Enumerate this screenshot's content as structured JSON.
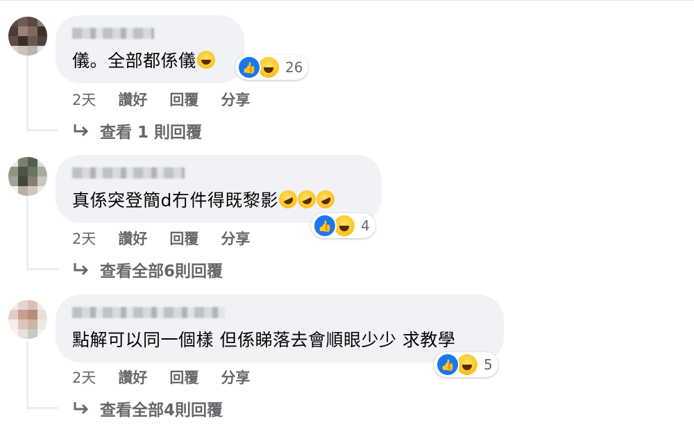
{
  "comments": [
    {
      "text": "儀。全部都係儀",
      "emoji": [
        "laugh"
      ],
      "reactions": {
        "icons": [
          "like-icon",
          "haha-icon"
        ],
        "count": "26"
      },
      "actions": {
        "time": "2天",
        "like": "讚好",
        "reply": "回覆",
        "share": "分享"
      },
      "view_replies": "查看 1 則回覆"
    },
    {
      "text": "真係突登簡d冇件得既黎影",
      "emoji": [
        "rofl",
        "rofl",
        "rofl"
      ],
      "reactions": {
        "icons": [
          "like-icon",
          "haha-icon"
        ],
        "count": "4"
      },
      "actions": {
        "time": "2天",
        "like": "讚好",
        "reply": "回覆",
        "share": "分享"
      },
      "view_replies": "查看全部6則回覆"
    },
    {
      "text": "點解可以同一個樣 但係睇落去會順眼少少 求教學",
      "emoji": [],
      "reactions": {
        "icons": [
          "like-icon",
          "haha-icon"
        ],
        "count": "5"
      },
      "actions": {
        "time": "2天",
        "like": "讚好",
        "reply": "回覆",
        "share": "分享"
      },
      "view_replies": "查看全部4則回覆"
    }
  ],
  "colors": {
    "like": "#1877f2",
    "bubble": "#f0f2f5",
    "secondary_text": "#65676b"
  }
}
